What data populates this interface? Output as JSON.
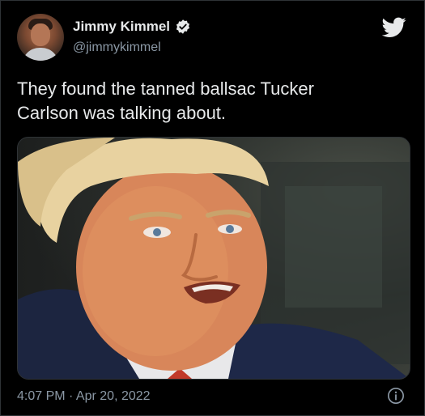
{
  "author": {
    "name": "Jimmy Kimmel",
    "handle": "@jimmykimmel",
    "verified": true
  },
  "tweet": {
    "text": "They found the tanned ballsac Tucker\nCarlson was talking about."
  },
  "media": {
    "type": "photo"
  },
  "meta": {
    "timestamp": "4:07 PM · Apr 20, 2022"
  },
  "icons": {
    "logo": "twitter-bird-icon",
    "verified": "verified-badge-icon",
    "info": "info-icon"
  },
  "colors": {
    "background": "#000000",
    "text": "#e7e9ea",
    "secondary": "#8b98a5",
    "brand": "#1d9bf0"
  }
}
